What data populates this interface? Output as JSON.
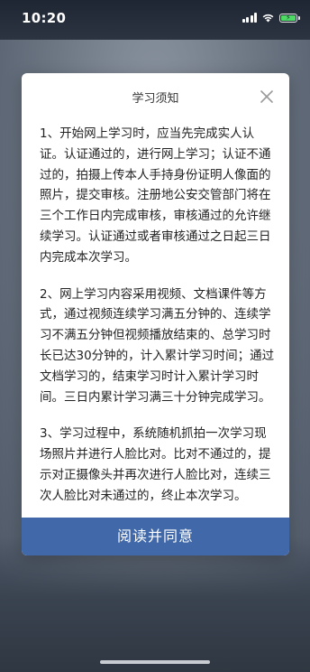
{
  "status_bar": {
    "time": "10:20"
  },
  "dialog": {
    "title": "学习须知",
    "close_icon": "close-icon",
    "paragraphs": [
      "1、开始网上学习时，应当先完成实人认证。认证通过的，进行网上学习；认证不通过的，拍摄上传本人手持身份证明人像面的照片，提交审核。注册地公安交管部门将在三个工作日内完成审核，审核通过的允许继续学习。认证通过或者审核通过之日起三日内完成本次学习。",
      "2、网上学习内容采用视频、文档课件等方式，通过视频连续学习满五分钟的、连续学习不满五分钟但视频播放结束的、总学习时长已达30分钟的，计入累计学习时间；通过文档学习的，结束学习时计入累计学习时间。三日内累计学习满三十分钟完成学习。",
      "3、学习过程中，系统随机抓拍一次学习现场照片并进行人脸比对。比对不通过的，提示对正摄像头并再次进行人脸比对，连续三次人脸比对未通过的，终止本次学习。"
    ],
    "agree_label": "阅读并同意",
    "accent_color": "#4169a9"
  }
}
